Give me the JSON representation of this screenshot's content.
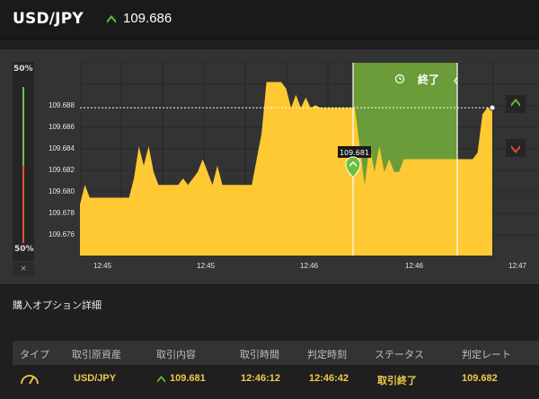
{
  "header": {
    "pair": "USD/JPY",
    "price": "109.686",
    "direction_icon": "up-arrow-icon",
    "direction_color": "#6cbf3c"
  },
  "meter": {
    "top_label": "50%",
    "bottom_label": "50%",
    "close_label": "×",
    "up_color": "#6cbf3c",
    "down_color": "#e0533a"
  },
  "chart": {
    "end_label": "終了",
    "entry_marker_label": "109.681",
    "area_color": "#ffc933",
    "zone_color": "#6fa23a",
    "buttons": [
      {
        "name": "high-button",
        "icon": "up-arrow-icon",
        "color": "#6cbf3c"
      },
      {
        "name": "low-button",
        "icon": "down-arrow-icon",
        "color": "#e0533a"
      }
    ]
  },
  "chart_data": {
    "type": "area",
    "title": "",
    "y_ticks": [
      "109.688",
      "109.686",
      "109.684",
      "109.682",
      "109.680",
      "109.678",
      "109.676"
    ],
    "x_ticks": [
      "12:45",
      "12:45",
      "12:46",
      "12:46",
      "12:47"
    ],
    "ylim": [
      109.6745,
      109.6895
    ],
    "current_price": 109.686,
    "entry_price": 109.681,
    "series": [
      {
        "values": [
          109.6785,
          109.68,
          109.679,
          109.679,
          109.679,
          109.679,
          109.679,
          109.679,
          109.679,
          109.679,
          109.679,
          109.6805,
          109.683,
          109.6815,
          109.683,
          109.681,
          109.68,
          109.68,
          109.68,
          109.68,
          109.68,
          109.6805,
          109.68,
          109.6805,
          109.681,
          109.682,
          109.681,
          109.68,
          109.6815,
          109.68,
          109.68,
          109.68,
          109.68,
          109.68,
          109.68,
          109.68,
          109.682,
          109.684,
          109.688,
          109.688,
          109.688,
          109.688,
          109.6875,
          109.686,
          109.687,
          109.686,
          109.6868,
          109.686,
          109.6862,
          109.686,
          109.686,
          109.686,
          109.686,
          109.686,
          109.686,
          109.686,
          109.686,
          109.683,
          109.68,
          109.683,
          109.681,
          109.683,
          109.681,
          109.682,
          109.681,
          109.681,
          109.682,
          109.682,
          109.682,
          109.682,
          109.682,
          109.682,
          109.682,
          109.682,
          109.682,
          109.682,
          109.682,
          109.682,
          109.682,
          109.682,
          109.682,
          109.6825,
          109.6855,
          109.686,
          109.686
        ]
      }
    ]
  },
  "details": {
    "title": "購入オプション詳細"
  },
  "table": {
    "headers": [
      "タイプ",
      "取引原資産",
      "取引内容",
      "取引時間",
      "判定時刻",
      "ステータス",
      "判定レート"
    ],
    "row": {
      "asset": "USD/JPY",
      "content": "109.681",
      "trade_time": "12:46:12",
      "judge_time": "12:46:42",
      "status": "取引終了",
      "judge_rate": "109.682"
    }
  }
}
